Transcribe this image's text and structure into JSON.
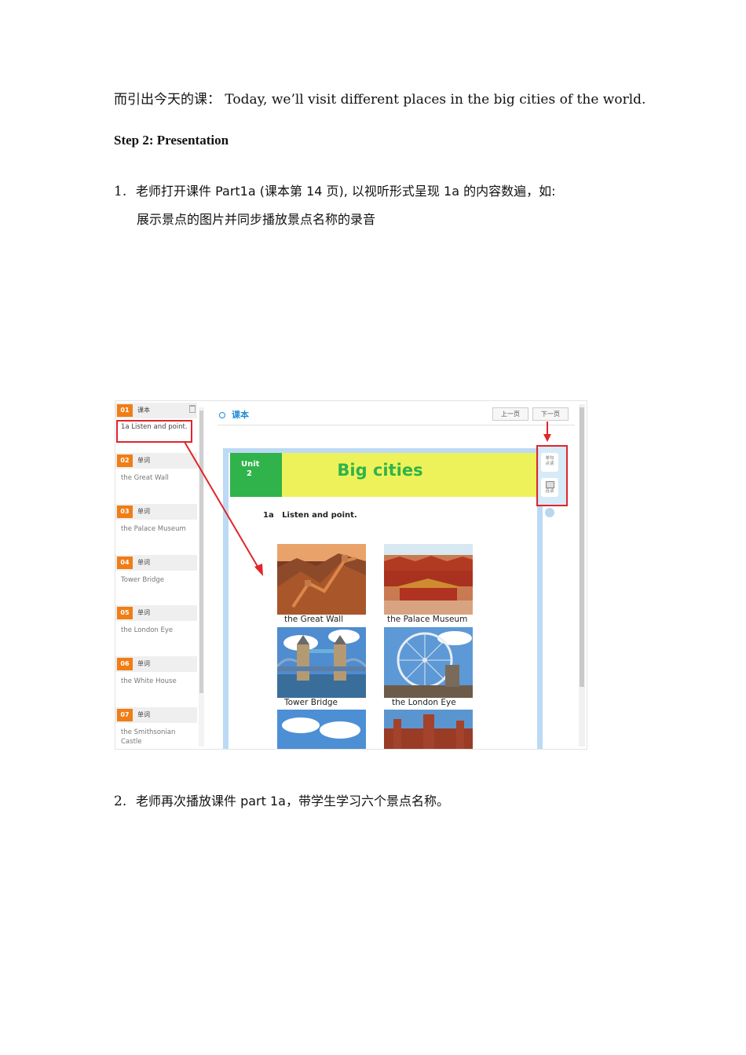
{
  "intro_line": {
    "prefix": "而引出今天的课：",
    "english": "Today, we’ll visit different places in the big cities of the world."
  },
  "step_heading": "Step 2: Presentation",
  "item1": {
    "num": "1.",
    "line1": "老师打开课件 Part1a (课本第 14 页), 以视听形式呈现 1a 的内容数遍，如:",
    "line2": "展示景点的图片并同步播放景点名称的录音"
  },
  "item2": {
    "num": "2.",
    "text": "老师再次播放课件 part 1a，带学生学习六个景点名称。"
  },
  "screenshot": {
    "sidebar": [
      {
        "num": "01",
        "type": "课本",
        "text": "1a Listen and point."
      },
      {
        "num": "02",
        "type": "单词",
        "text": "the Great Wall"
      },
      {
        "num": "03",
        "type": "单词",
        "text": "the Palace Museum"
      },
      {
        "num": "04",
        "type": "单词",
        "text": "Tower Bridge"
      },
      {
        "num": "05",
        "type": "单词",
        "text": "the London Eye"
      },
      {
        "num": "06",
        "type": "单词",
        "text": "the White House"
      },
      {
        "num": "07",
        "type": "单词",
        "text": "the Smithsonian Castle"
      }
    ],
    "title": "课本",
    "prev_button": "上一页",
    "next_button": "下一页",
    "unit_label": "Unit",
    "unit_number": "2",
    "page_title": "Big cities",
    "exercise_label": "1a   Listen and point.",
    "toolbar": {
      "btn1": "单句点读",
      "btn2": "连读"
    },
    "captions": [
      "the Great Wall",
      "the Palace Museum",
      "Tower Bridge",
      "the London Eye"
    ],
    "colors": {
      "accent_orange": "#f07d16",
      "highlight_red": "#e0252b",
      "unit_green": "#2fb34a",
      "banner_yellow": "#eef25a",
      "link_blue": "#1e8bd8"
    }
  }
}
